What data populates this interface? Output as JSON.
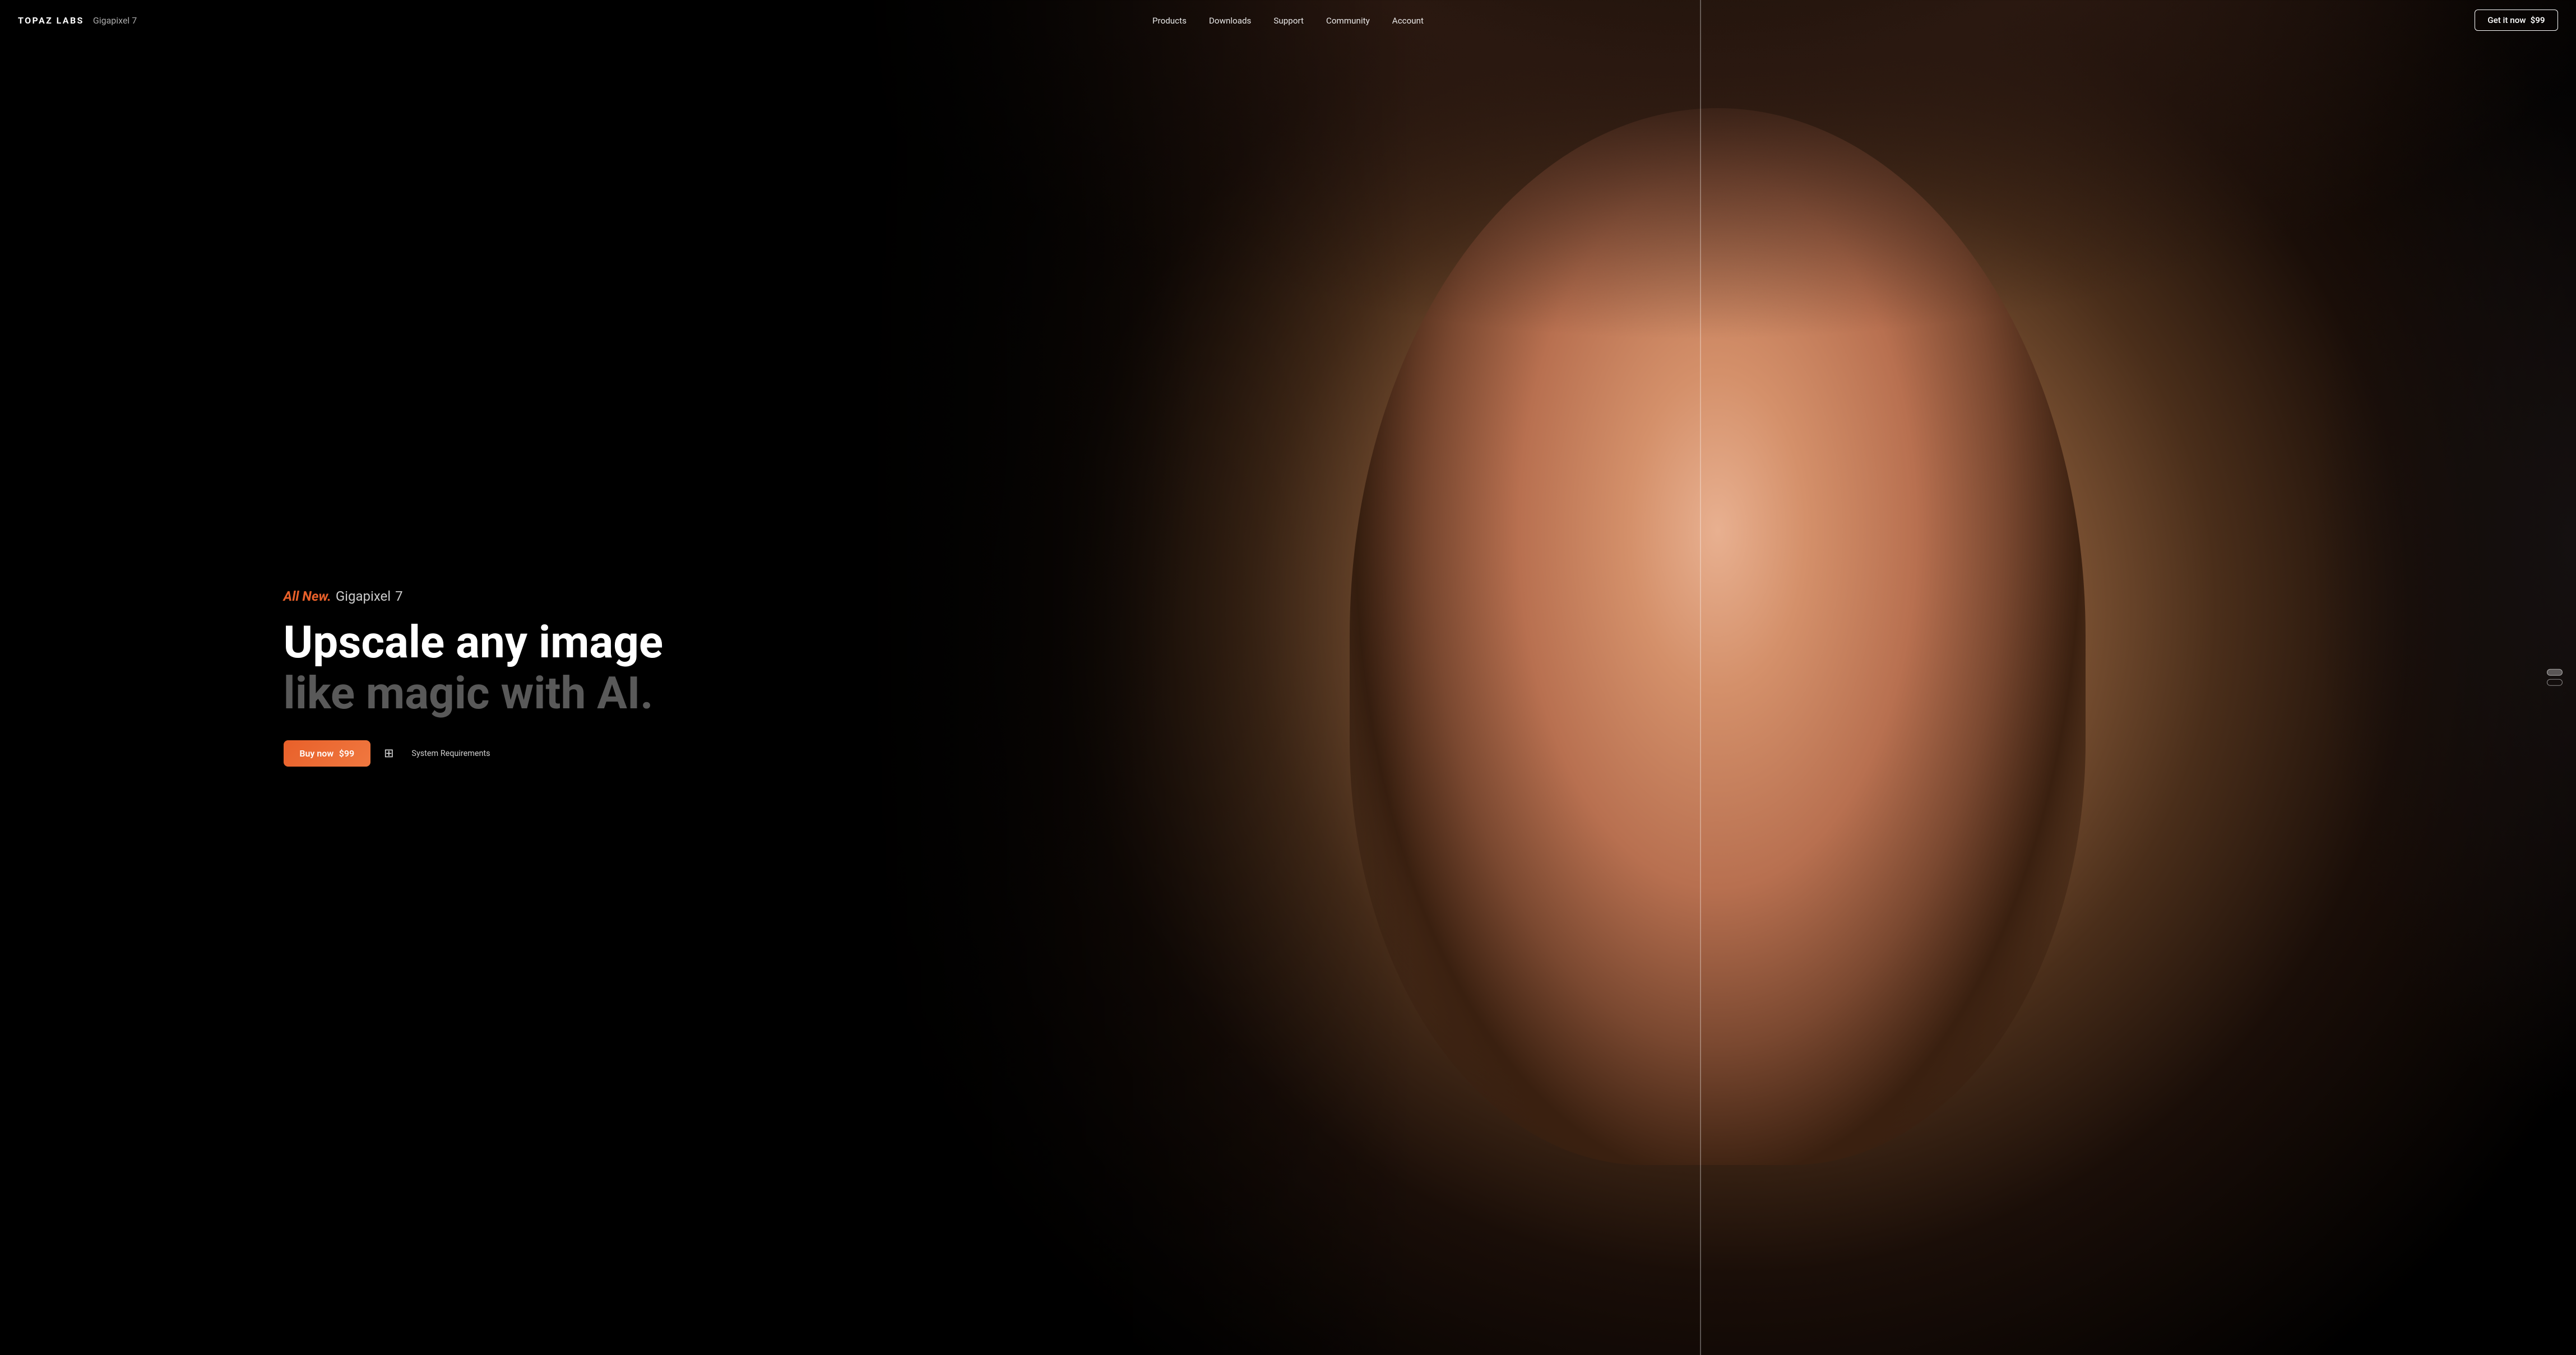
{
  "brand": {
    "name": "TOPAZ LABS",
    "product": "Gigapixel 7"
  },
  "nav": {
    "items": [
      {
        "label": "Products",
        "href": "#"
      },
      {
        "label": "Downloads",
        "href": "#"
      },
      {
        "label": "Support",
        "href": "#"
      },
      {
        "label": "Community",
        "href": "#"
      },
      {
        "label": "Account",
        "href": "#"
      }
    ]
  },
  "cta": {
    "label": "Get it now",
    "price": "$99"
  },
  "hero": {
    "badge_new": "All New.",
    "badge_product": "Gigapixel",
    "badge_number": "7",
    "headline_1": "Upscale any image",
    "headline_2": "like magic with AI.",
    "buy_label": "Buy now",
    "buy_price": "$99",
    "system_req": "System Requirements"
  },
  "scroll": {
    "dots": [
      {
        "active": true
      },
      {
        "active": false
      }
    ]
  }
}
